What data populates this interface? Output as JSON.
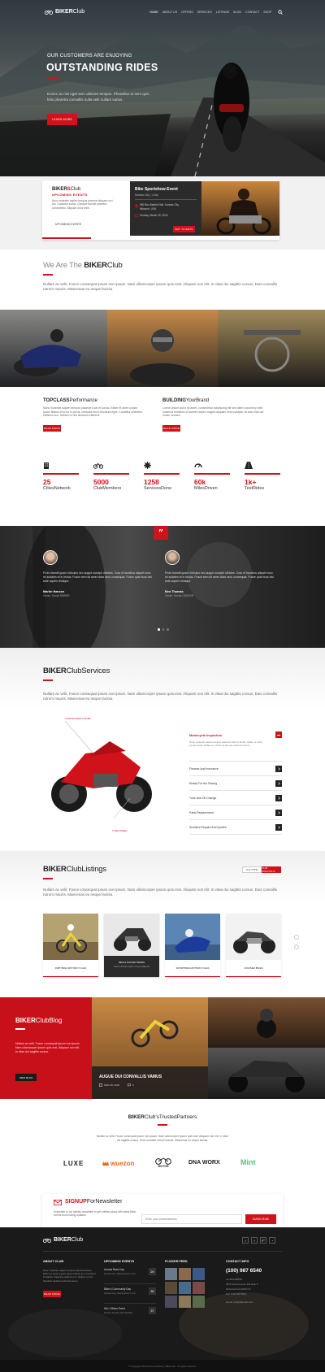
{
  "brand": {
    "bold": "BIKER",
    "light": "Club"
  },
  "nav": [
    "HOME",
    "ABOUT US",
    "OFFERS",
    "SERVICES",
    "LISTINGS",
    "BLOG",
    "CONTACT",
    "SHOP"
  ],
  "hero": {
    "kicker": "OUR CUSTOMERS ARE ENJOYING",
    "title": "OUTSTANDING RIDES",
    "text1": "Donec ac nisi eget sem ultricies tempus. Phasellus et sem quis",
    "text2": "felis pharetra convallis nulla velit nullam varius.",
    "button": "LEARN MORE"
  },
  "events": {
    "title_bold": "BIKER",
    "title_s": "S",
    "title_light": "Club",
    "subtitle": "UPCOMING EVENTS",
    "text": "Nunc molestie sapien tempus placerat aliquam orci leo. Curabitur luctus. Quisque blandit pharetra consectetur. Aliquam urna enim.",
    "link": "UPCOMING EVENTS",
    "card_title": "Bike Sportshow Event",
    "card_sub": "Kansas City | 1 Day",
    "card_addr1": "980 Bus Bartlett Hall, Kansas City,",
    "card_addr2": "Missouri, USA",
    "card_date": "Sunday, March 29, 2015",
    "card_btn": "BUY TICKETS"
  },
  "about": {
    "pre": "We Are The ",
    "bold": "BIKER",
    "post": "Club",
    "text": "Nullam ac velit. Fusce consequat ipsum non ipsum. Nam ullamcorper ipsum quis erat. Aliquam non elit. In vitae dui sagittis cursus. Duis convallis rutrum mauris. Maecenas eu neque lacinia."
  },
  "features": [
    {
      "bold": "TOPCLASS",
      "light": "Performance",
      "text": "Nunc molestie sapien tempus placerat Duis et luctus. Etiam et amet a justo quam finibus et id sit in purus, vehicula est in tincidunt eget. Curabitur pharetra eleifend orci. Nullam ut nisi tincidunt eleifend.",
      "btn": "READ MORE"
    },
    {
      "bold": "BUILDING",
      "light": "YourBrand",
      "text": "Lorem ipsum dolor sit amet, consectetur adipiscing elit sed diam nonummy nibh euismod tincidunt ut laoreet dolore magna aliquam erat volutpat. Ut wisi enim ad minim veniam.",
      "btn": "READ MORE"
    }
  ],
  "stats": [
    {
      "num": "25",
      "label": "CitiesNetwork"
    },
    {
      "num": "5000",
      "label": "ClubMembers"
    },
    {
      "num": "1258",
      "label": "ServicesDone"
    },
    {
      "num": "60k",
      "label": "MilesDriven"
    },
    {
      "num": "1k+",
      "label": "TestRides"
    }
  ],
  "testimonials": [
    {
      "text": "Proin blandit quam ridiculus nec augue suscipit ultricies. Cras et faucibus aliquet nunc mi sodales et in lectus. Fusce sem sit amet dolor arcu consequat. Fusce quis risus nisi ante sapien tristique.",
      "name": "Martin Hansen",
      "role": "Owner, Ducati SMRDR"
    },
    {
      "text": "Proin blandit quam ridiculus nec augue suscipit ultricies. Cras et faucibus aliquet nunc mi sodales et in lectus. Fusce sem sit amet dolor arcu consequat. Fusce quis risus nisi ante sapien tristique.",
      "name": "Ben Thomas",
      "role": "Owner, Honda CB1000R"
    }
  ],
  "services": {
    "bold": "BIKER",
    "light": "ClubServices",
    "text": "Nullam ac velit. Fusce consequat ipsum non ipsum. Nam ullamcorper ipsum quis erat. Aliquam non elit. In vitae dui sagittis cursus. Duis convallis rutrum mauris. Maecenas eu neque lacinia.",
    "label_top": "LIGHTING BODY SYSTEM",
    "label_bottom": "TYRES WHEEL",
    "accordion_title": "Motorcycle Inspection",
    "accordion_text": "Nunc molestie sapien tempus placerat Duis et luctus. Etiam et amet a justo quam finibus et. Vivamus laoreet euismod lectus.",
    "items": [
      "Finance And Insurance",
      "Ready For the Racing",
      "Tune And Oil Change",
      "Parts Replacement",
      "Accident Repairs And Quotes"
    ]
  },
  "listings": {
    "bold": "BIKER",
    "light": "ClubListings",
    "tab1": "ALL TYPE",
    "tab2": "OUR SPECIALS",
    "text": "Nullam ac velit. Fusce consequat ipsum non ipsum. Nam ullamcorper ipsum quis erat. Aliquam non elit. In vitae dui sagittis cursus. Duis convallis rutrum mauris. Maecenas eu neque lacinia.",
    "items": [
      {
        "label": "DIRT BIKE MOTORCYCLES"
      },
      {
        "label": "MINI & POCKET BIKES",
        "sub": "Nunc molestie sapien tempus placerat"
      },
      {
        "label": "SPORTBIKE MOTORCYCLES"
      },
      {
        "label": "CRUISER BIKES"
      }
    ]
  },
  "blog": {
    "bold": "BIKER",
    "light": "ClubBlog",
    "text": "Nullam ac velit. Fusce consequat ipsum non ipsum. Nam ullamcorper ipsum quis erat. Aliquam non elit. In vitae dui sagittis cursus.",
    "btn": "VIEW BLOG",
    "post_title": "AUGUE DUI CONVALLIS VAMUS",
    "post_date": "MAR 28, 2015",
    "post_comments": "6"
  },
  "partners": {
    "bold": "BIKER",
    "light": "Club'sTrustedPartners",
    "text": "Nullam ac velit. Fusce consequat ipsum non ipsum. Nam ullamcorper ipsum quis erat. Aliquam non elit. In vitae dui sagittis cursus. Duis convallis rutrum mauris. Maecenas eu neque lacinia.",
    "logos": [
      "LUXE",
      "wuezon",
      "MOTOR",
      "DNA WORX",
      "Mint"
    ]
  },
  "newsletter": {
    "bold": "SIGNUP",
    "light": "ForNewsletter",
    "text": "Subscribe to our weekly newsletter to get notified about with latest Biker events and exciting updates.",
    "placeholder": "Enter your email address",
    "btn": "SUBSCRIBE"
  },
  "footer": {
    "about_title": "ABOUT CLUB",
    "about_text": "Nunc molestie sapien tempus placerat luctus. Etiam et amet a justo quam finibus et in tincidunt. Curabitur pharetra eleifend orci. Nullam ut nisi tincidunt eleifend vehicula lorem.",
    "about_btn": "READ MORE",
    "events_title": "UPCOMING EVENTS",
    "events": [
      {
        "name": "Annual Race Day",
        "meta": "Kansas City | Racing Event | 1 Dy",
        "day": "29"
      },
      {
        "name": "Biker's Community Day",
        "meta": "Kansas City | Racing Event | 2 Dy",
        "day": "30"
      },
      {
        "name": "Win 1 Bikes Event",
        "meta": "Kansas Junction April 28 2015",
        "day": "37"
      }
    ],
    "flickr_title": "FLICKER FEED",
    "contact_title": "CONTACT INFO",
    "phone": "(100) 987 6540",
    "contact_lines": [
      "CLUB HARBOR",
      "3570 Grand Avenue 6/E Suite 8",
      "Richmond CA 12345 US",
      "Fax: (100) 987 6541"
    ],
    "email": "E-mail: info@bikeclub.com",
    "copyright": "© Copyright 2015 by ThemeWinter | BikerClub - All rights reserved."
  },
  "colors": {
    "accent": "#d0121a",
    "dark": "#1a1a1a"
  },
  "icons": [
    "search-icon",
    "calendar-icon",
    "pin-icon",
    "building-icon",
    "bike-icon",
    "gear-icon",
    "speedometer-icon",
    "road-icon",
    "quote-icon",
    "chevron-right-icon",
    "twitter-icon",
    "facebook-icon",
    "google-plus-icon",
    "rss-icon"
  ]
}
